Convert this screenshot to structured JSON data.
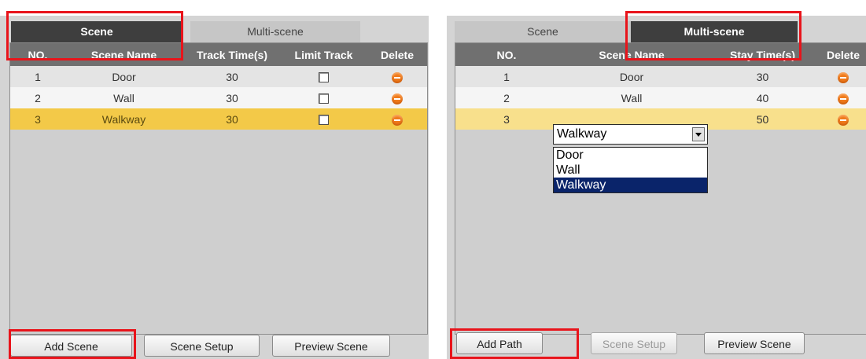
{
  "left": {
    "tabs": [
      {
        "label": "Scene",
        "active": true
      },
      {
        "label": "Multi-scene",
        "active": false
      }
    ],
    "columns": [
      "NO.",
      "Scene Name",
      "Track Time(s)",
      "Limit Track",
      "Delete"
    ],
    "rows": [
      {
        "no": "1",
        "name": "Door",
        "time": "30",
        "limit": false
      },
      {
        "no": "2",
        "name": "Wall",
        "time": "30",
        "limit": false
      },
      {
        "no": "3",
        "name": "Walkway",
        "time": "30",
        "limit": false,
        "selected": true
      }
    ],
    "buttons": {
      "add": "Add Scene",
      "setup": "Scene Setup",
      "preview": "Preview Scene"
    }
  },
  "right": {
    "tabs": [
      {
        "label": "Scene",
        "active": false
      },
      {
        "label": "Multi-scene",
        "active": true
      }
    ],
    "columns": [
      "NO.",
      "Scene Name",
      "Stay Time(s)",
      "Delete"
    ],
    "rows": [
      {
        "no": "1",
        "name": "Door",
        "time": "30"
      },
      {
        "no": "2",
        "name": "Wall",
        "time": "40"
      },
      {
        "no": "3",
        "name": "Walkway",
        "time": "50",
        "selected": true
      }
    ],
    "dropdown": {
      "value": "Walkway",
      "options": [
        "Door",
        "Wall",
        "Walkway"
      ],
      "selected_index": 2
    },
    "buttons": {
      "add": "Add Path",
      "setup": "Scene Setup",
      "preview": "Preview Scene",
      "setup_disabled": true
    }
  },
  "colors": {
    "selected_row": "#f3c948",
    "highlight": "#e8141b",
    "delete_icon": "#f07a1a",
    "active_tab": "#3e3e3e"
  },
  "icons": {
    "delete": "minus-circle-icon",
    "checkbox": "checkbox-unchecked",
    "combo_arrow": "chevron-down-icon"
  }
}
